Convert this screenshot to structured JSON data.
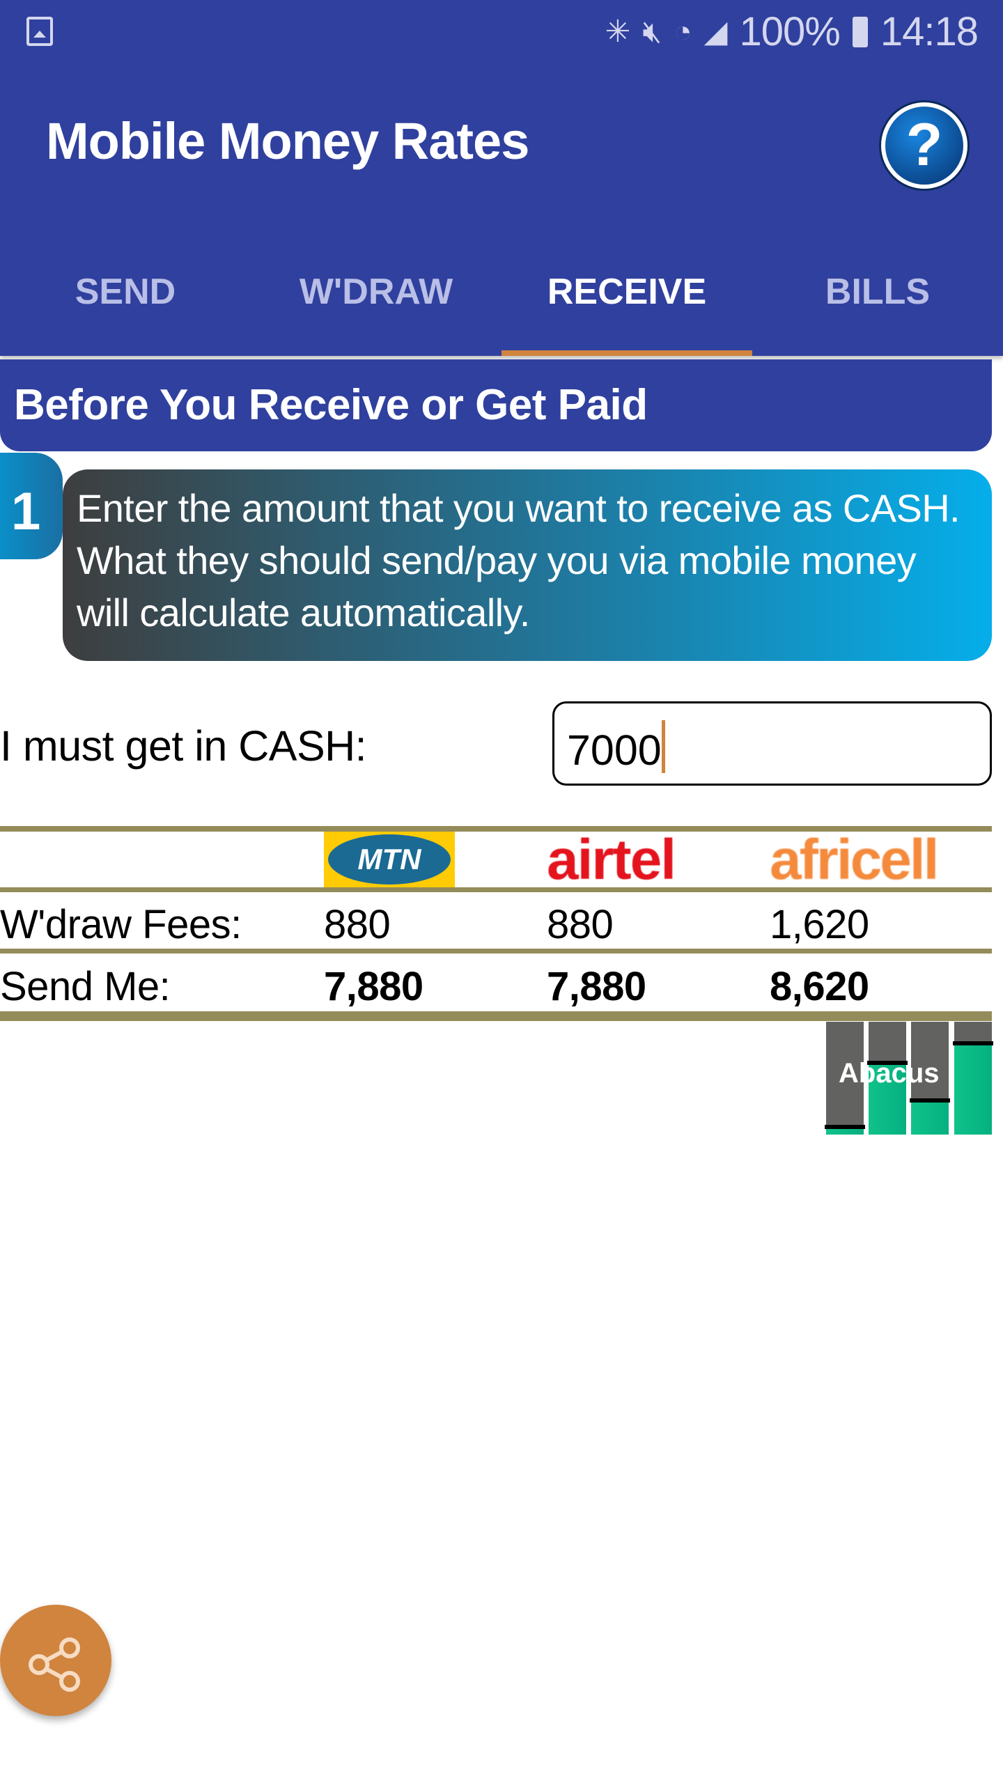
{
  "status_bar": {
    "battery": "100%",
    "time": "14:18",
    "icons": [
      "image-icon",
      "bluetooth-icon",
      "mute-icon",
      "wifi-icon",
      "signal-icon",
      "battery-icon"
    ]
  },
  "app": {
    "title": "Mobile Money Rates",
    "help_icon": "?"
  },
  "tabs": [
    {
      "label": "SEND",
      "active": false
    },
    {
      "label": "W'DRAW",
      "active": false
    },
    {
      "label": "RECEIVE",
      "active": true
    },
    {
      "label": "BILLS",
      "active": false
    }
  ],
  "section": {
    "heading": "Before You Receive or Get Paid"
  },
  "step": {
    "number": "1",
    "text": "Enter the amount that you want to receive as CASH. What they should send/pay you via mobile money will calculate automatically."
  },
  "cash_input": {
    "label": "I must get in CASH:",
    "value": "7000"
  },
  "table": {
    "providers": [
      "MTN",
      "airtel",
      "africell"
    ],
    "rows": [
      {
        "label": "W'draw Fees:",
        "values": [
          "880",
          "880",
          "1,620"
        ]
      },
      {
        "label": "Send Me:",
        "values": [
          "7,880",
          "7,880",
          "8,620"
        ]
      }
    ]
  },
  "abacus_logo": "Abacus",
  "colors": {
    "primary": "#30409e",
    "accent": "#d0843e",
    "table_line": "#948b5a"
  }
}
